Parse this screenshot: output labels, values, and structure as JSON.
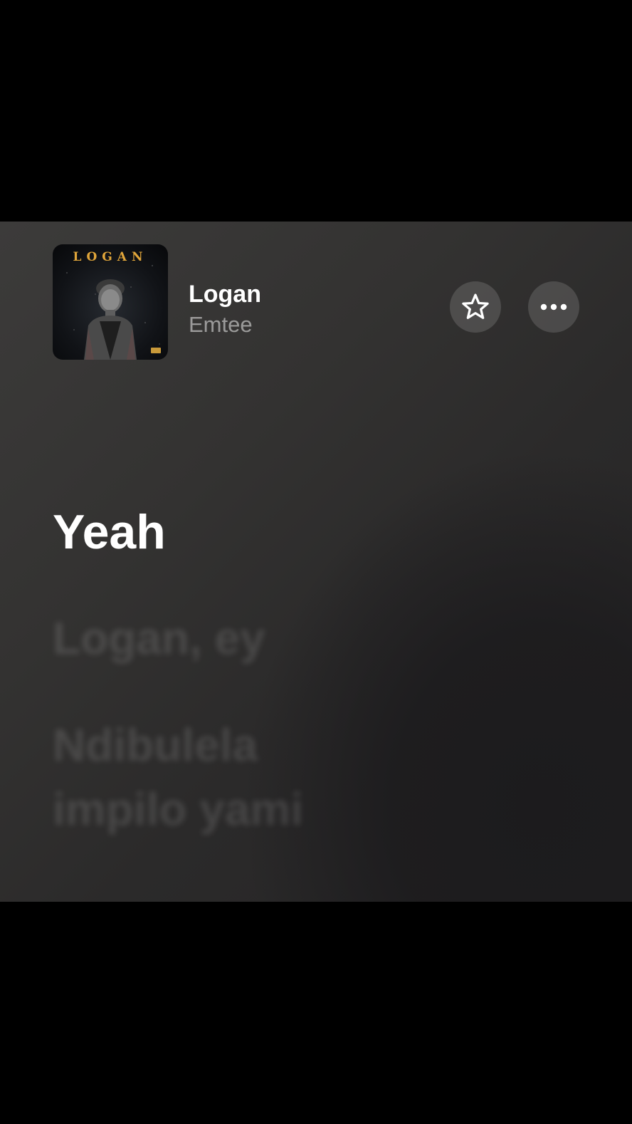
{
  "now_playing": {
    "album_art": {
      "title": "LOGAN"
    },
    "title": "Logan",
    "artist": "Emtee"
  },
  "buttons": {
    "favorite_icon": "star-icon",
    "more_icon": "ellipsis-icon"
  },
  "lyrics": {
    "current": "Yeah",
    "upcoming": [
      "Logan, ey",
      "Ndibulela",
      "impilo yami"
    ]
  }
}
